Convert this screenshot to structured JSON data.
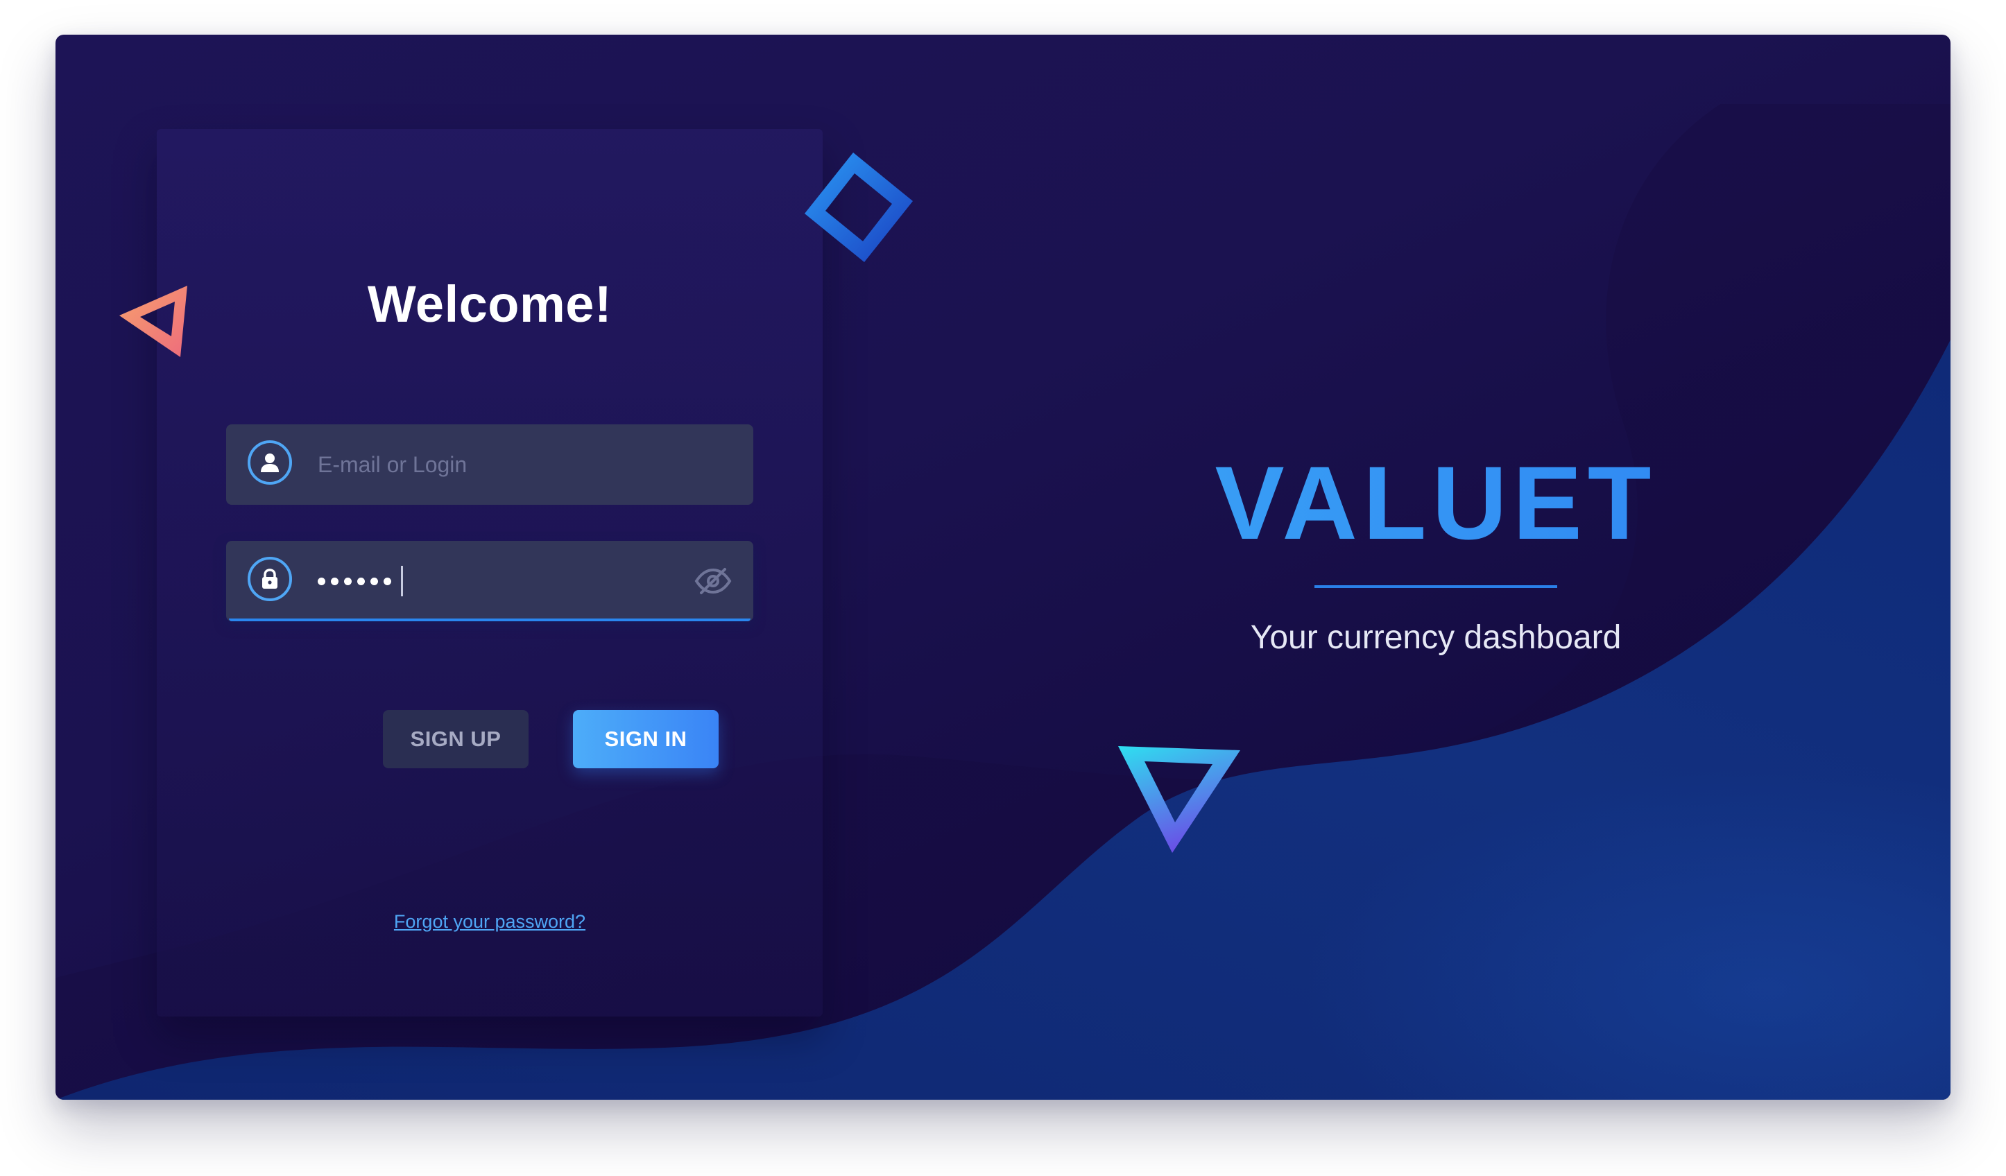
{
  "login": {
    "heading": "Welcome!",
    "email_placeholder": "E-mail or Login",
    "email_value": "",
    "password_mask_length": 6,
    "signup_label": "SIGN UP",
    "signin_label": "SIGN IN",
    "forgot_link": "Forgot your password?"
  },
  "brand": {
    "name": "VALUET",
    "tagline": "Your currency dashboard"
  },
  "icons": {
    "email": "user-icon",
    "password": "lock-icon",
    "visibility": "eye-off-icon"
  },
  "colors": {
    "accent": "#3a93f5",
    "background": "#1a1150",
    "field": "#323659",
    "signin_gradient_start": "#4dadf9",
    "signin_gradient_end": "#3a84f6",
    "signup_bg": "#2a2e52"
  }
}
